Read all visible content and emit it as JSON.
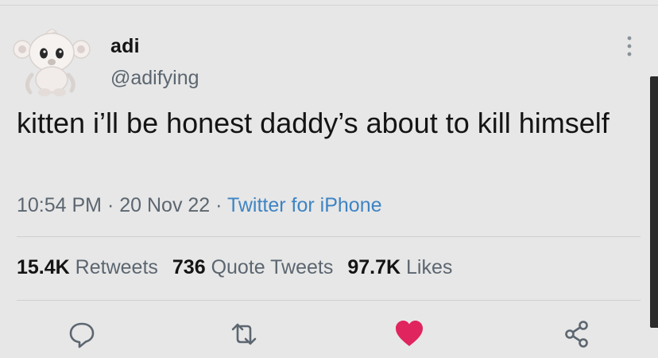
{
  "author": {
    "name": "adi",
    "handle": "@adifying"
  },
  "tweet": {
    "text": "kitten i’ll be honest daddy’s about to kill himself"
  },
  "meta": {
    "time": "10:54 PM",
    "separator": " · ",
    "date": "20 Nov 22",
    "source": "Twitter for iPhone"
  },
  "stats": {
    "retweets_count": "15.4K",
    "retweets_label": "Retweets",
    "quotes_count": "736",
    "quotes_label": "Quote Tweets",
    "likes_count": "97.7K",
    "likes_label": "Likes"
  },
  "actions": {
    "reply_icon": "reply-icon",
    "retweet_icon": "retweet-icon",
    "like_icon": "heart-icon",
    "like_color": "#e0245e",
    "share_icon": "share-icon"
  },
  "colors": {
    "background": "#e7e7e7",
    "text": "#141414",
    "secondary": "#5c6670",
    "link": "#3e84c4"
  }
}
